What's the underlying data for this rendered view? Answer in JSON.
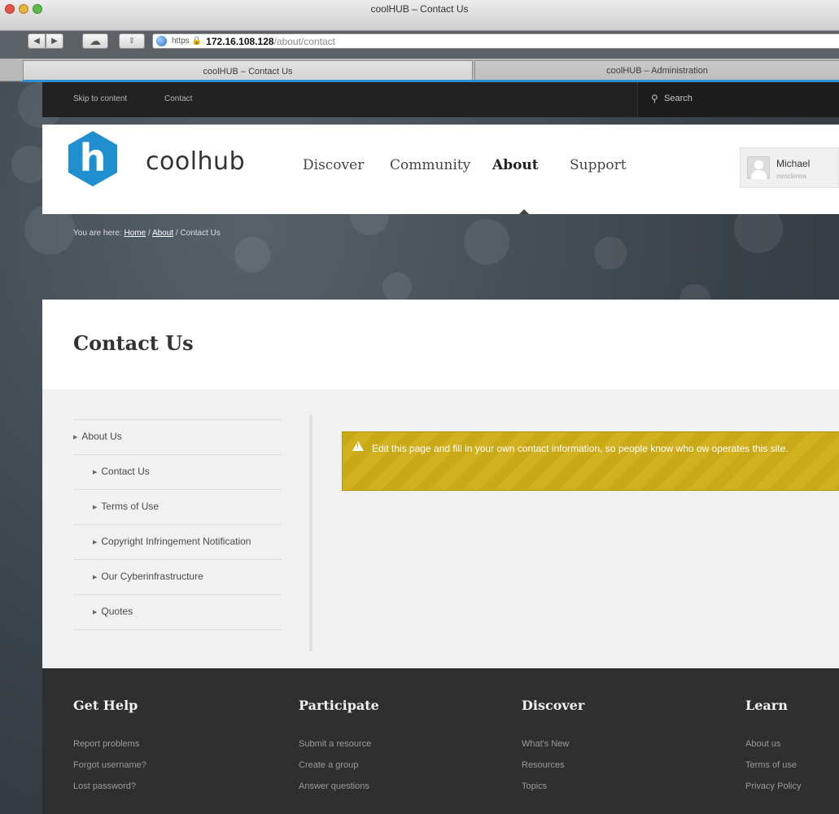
{
  "browser": {
    "window_title": "coolHUB – Contact Us",
    "url": {
      "scheme": "https",
      "host": "172.16.108.128",
      "path": "/about/contact"
    },
    "tabs": [
      {
        "label": "coolHUB – Contact Us",
        "active": true
      },
      {
        "label": "coolHUB – Administration",
        "active": false
      }
    ]
  },
  "utility_bar": {
    "skip_link": "Skip to content",
    "contact_link": "Contact",
    "search_placeholder": "Search"
  },
  "header": {
    "logo_letter": "h",
    "logo_text": "coolhub",
    "nav": [
      "Discover",
      "Community",
      "About",
      "Support"
    ],
    "active_nav": "About",
    "user": {
      "name": "Michael",
      "login": "mmclenna"
    }
  },
  "breadcrumb": {
    "prefix": "You are here:",
    "items": [
      "Home",
      "About",
      "Contact Us"
    ]
  },
  "page_title": "Contact Us",
  "subnav": {
    "parent": "About Us",
    "children": [
      "Contact Us",
      "Terms of Use",
      "Copyright Infringement Notification",
      "Our Cyberinfrastructure",
      "Quotes"
    ]
  },
  "warning": {
    "text": "Edit this page and fill in your own contact information, so people know who ow operates this site."
  },
  "footer": {
    "columns": [
      {
        "heading": "Get Help",
        "links": [
          "Report problems",
          "Forgot username?",
          "Lost password?"
        ]
      },
      {
        "heading": "Participate",
        "links": [
          "Submit a resource",
          "Create a group",
          "Answer questions"
        ]
      },
      {
        "heading": "Discover",
        "links": [
          "What's New",
          "Resources",
          "Topics"
        ]
      },
      {
        "heading": "Learn",
        "links": [
          "About us",
          "Terms of use",
          "Privacy Policy"
        ]
      }
    ]
  },
  "colors": {
    "brand_blue": "#1f8fd0",
    "warning_yellow": "#c9a918",
    "footer_bg": "#2f2f2f"
  }
}
